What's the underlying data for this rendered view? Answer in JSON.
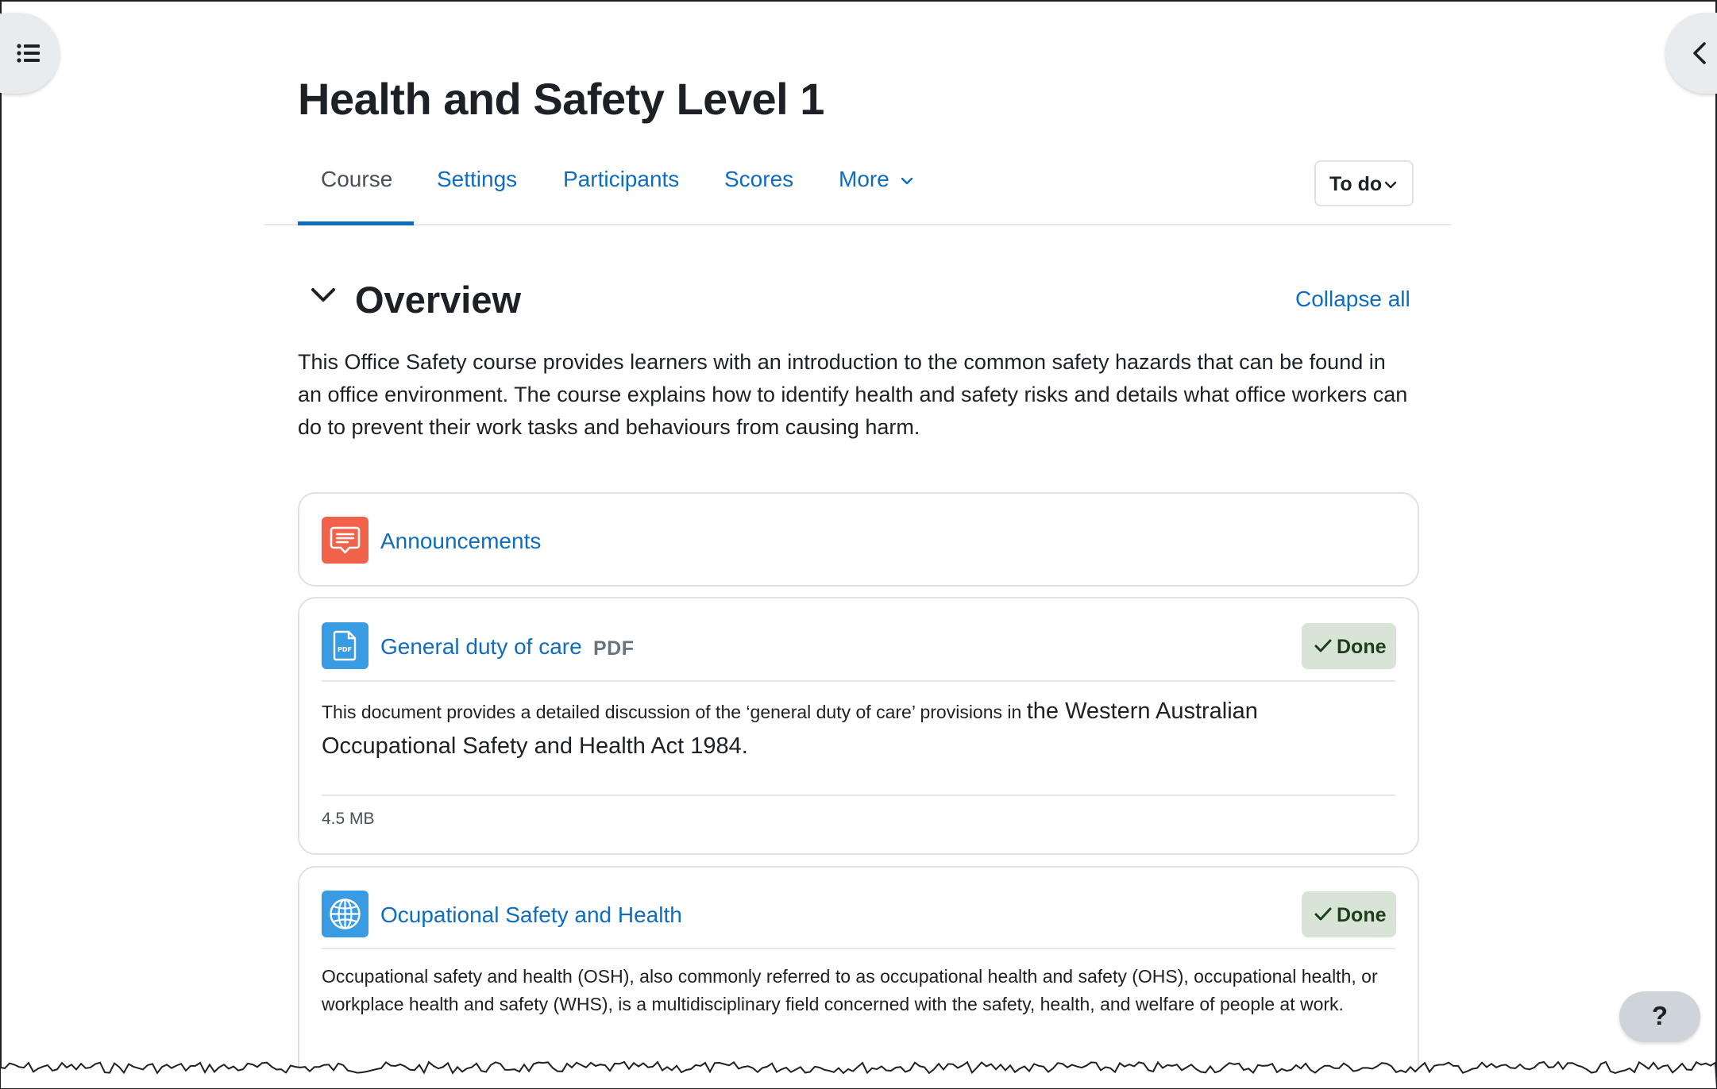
{
  "drawers": {
    "left_icon": "list-icon",
    "right_icon": "chevron-left-icon"
  },
  "course": {
    "title": "Health and Safety Level 1"
  },
  "secondary_nav": {
    "tabs": [
      {
        "label": "Course",
        "active": true
      },
      {
        "label": "Settings",
        "active": false
      },
      {
        "label": "Participants",
        "active": false
      },
      {
        "label": "Scores",
        "active": false
      },
      {
        "label": "More",
        "active": false
      }
    ],
    "todo_label": "To do"
  },
  "section": {
    "title": "Overview",
    "collapse_all_label": "Collapse all",
    "summary": "This Office Safety course provides learners with an introduction to the common safety hazards that can be found in an office environment. The course explains how to identify health and safety risks and details what office workers can do to prevent their work tasks and behaviours from causing harm."
  },
  "activities": [
    {
      "name": "Announcements",
      "icon": "forum-icon",
      "icon_color": "#f0624a"
    },
    {
      "name": "General duty of care",
      "type_label": "PDF",
      "icon": "pdf-icon",
      "icon_color": "#399be2",
      "status": "Done",
      "description_small": "This document provides a detailed discussion of the ‘general duty of care’ provisions in ",
      "description_large": "the Western Australian Occupational Safety and Health Act 1984.",
      "file_size": "4.5 MB"
    },
    {
      "name": "Ocupational Safety and Health",
      "icon": "globe-icon",
      "icon_color": "#399be2",
      "status": "Done",
      "description": "Occupational safety and health (OSH), also commonly referred to as occupational health and safety (OHS), occupational health, or workplace health and safety (WHS), is a multidisciplinary field concerned with the safety, health, and welfare of people at work."
    }
  ],
  "help": {
    "label": "?"
  },
  "colors": {
    "link": "#0f6cbf",
    "done_bg": "#d7e4d6",
    "done_text": "#1c3f1a"
  }
}
